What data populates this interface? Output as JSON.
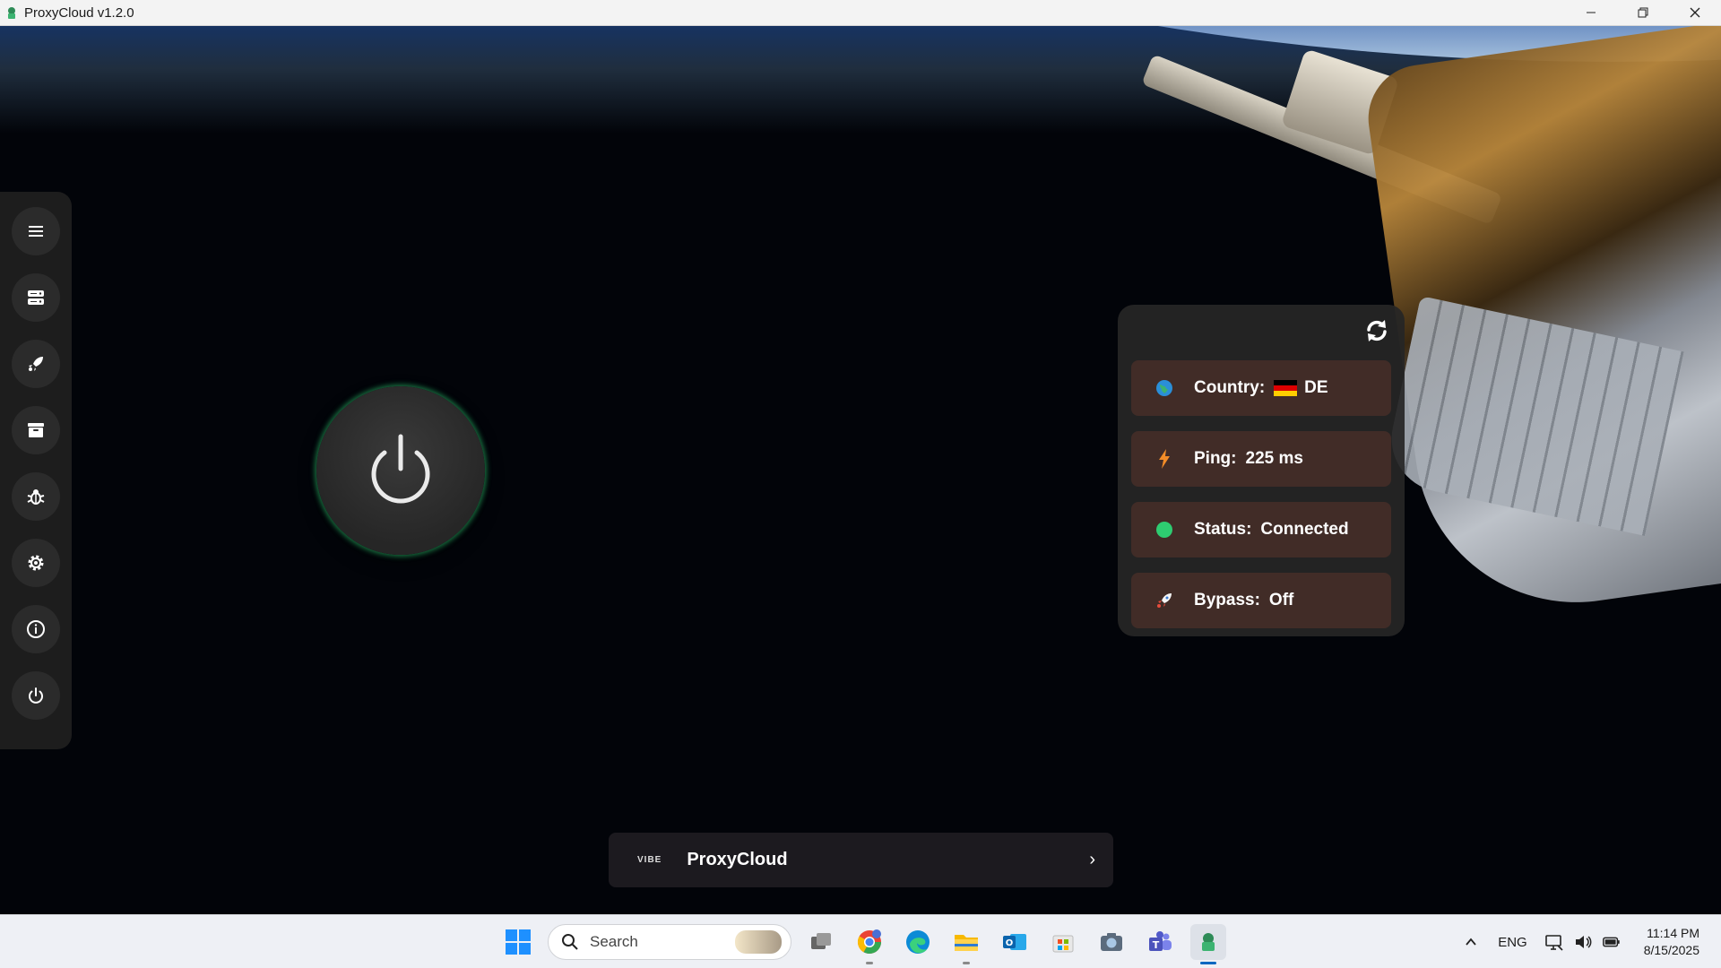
{
  "window": {
    "title": "ProxyCloud v1.2.0"
  },
  "sidebar": {
    "items": [
      {
        "icon": "menu-icon"
      },
      {
        "icon": "servers-icon"
      },
      {
        "icon": "rocket-icon"
      },
      {
        "icon": "archive-icon"
      },
      {
        "icon": "bug-icon"
      },
      {
        "icon": "gear-icon"
      },
      {
        "icon": "info-icon"
      },
      {
        "icon": "power-icon"
      }
    ]
  },
  "power_button": {
    "icon": "power-icon",
    "glow_color": "#2ecc71"
  },
  "info_panel": {
    "country": {
      "label": "Country:",
      "value": "DE",
      "flag": "germany-flag"
    },
    "ping": {
      "label": "Ping:",
      "value": "225 ms"
    },
    "status": {
      "label": "Status:",
      "value": "Connected",
      "color": "#2ecc71"
    },
    "bypass": {
      "label": "Bypass:",
      "value": "Off"
    }
  },
  "banner": {
    "logo": "VIBE",
    "title": "ProxyCloud"
  },
  "taskbar": {
    "search_placeholder": "Search",
    "language": "ENG",
    "time": "11:14 PM",
    "date": "8/15/2025"
  },
  "colors": {
    "accent": "#2ecc71",
    "panel_row": "#462e28",
    "sidebar_bg": "#1d1d1d"
  }
}
